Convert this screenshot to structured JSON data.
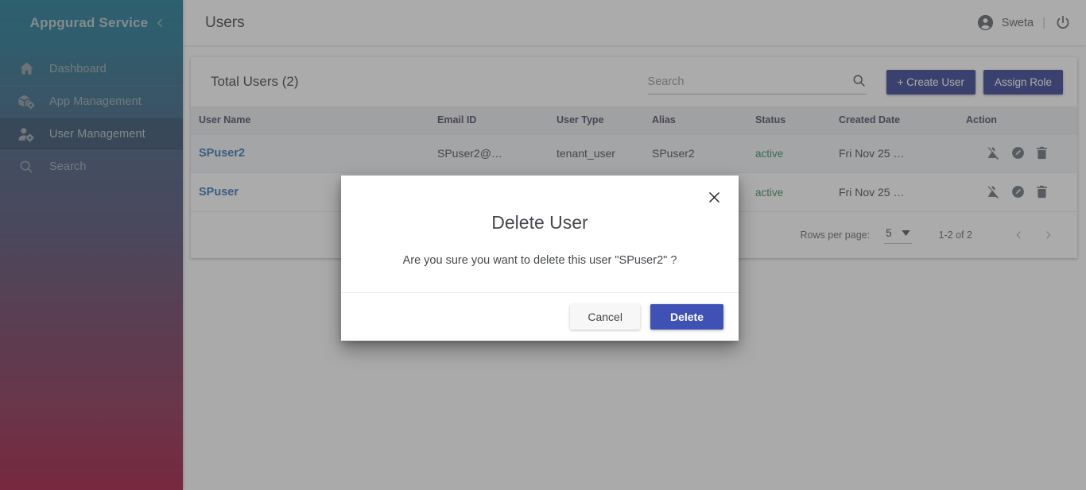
{
  "sidebar": {
    "brand": "Appgurad Service",
    "collapse_icon": "chevron-left-icon",
    "items": [
      {
        "label": "Dashboard",
        "icon": "home-icon",
        "active": false
      },
      {
        "label": "App Management",
        "icon": "box-gear-icon",
        "active": false
      },
      {
        "label": "User Management",
        "icon": "person-gear-icon",
        "active": true
      },
      {
        "label": "Search",
        "icon": "magnifier-icon",
        "active": false
      }
    ]
  },
  "topbar": {
    "title": "Users",
    "account_icon": "account-circle-icon",
    "account_name": "Sweta",
    "separator": "|",
    "power_icon": "power-icon"
  },
  "toolbar": {
    "total_users": "Total Users (2)",
    "search_placeholder": "Search",
    "search_value": "",
    "search_icon": "search-icon",
    "create_user_label": "+ Create User",
    "assign_role_label": "Assign Role",
    "button_color": "#2f3c8e"
  },
  "table": {
    "columns": [
      "User Name",
      "Email ID",
      "User Type",
      "Alias",
      "Status",
      "Created Date",
      "Action"
    ],
    "rows": [
      {
        "user_name": "SPuser2",
        "email": "SPuser2@…",
        "user_type": "tenant_user",
        "alias": "SPuser2",
        "status": "active",
        "created_date": "Fri Nov 25 …",
        "actions": [
          "person-off-icon",
          "edit-circle-icon",
          "delete-icon"
        ]
      },
      {
        "user_name": "SPuser",
        "email": "",
        "user_type": "",
        "alias": "",
        "status": "active",
        "created_date": "Fri Nov 25 …",
        "actions": [
          "person-off-icon",
          "edit-circle-icon",
          "delete-icon"
        ]
      }
    ],
    "status_color": "#2e8b57",
    "link_color": "#2f6fb5"
  },
  "pagination": {
    "rows_per_page_label": "Rows per page:",
    "rows_per_page_value": "5",
    "dropdown_icon": "caret-down-icon",
    "range_label": "1-2 of 2",
    "prev_icon": "chevron-left-icon",
    "next_icon": "chevron-right-icon"
  },
  "modal": {
    "close_icon": "close-icon",
    "title": "Delete User",
    "message": "Are you sure you want to delete this user \"SPuser2\" ?",
    "cancel_label": "Cancel",
    "delete_label": "Delete",
    "delete_color": "#3f51b5"
  }
}
